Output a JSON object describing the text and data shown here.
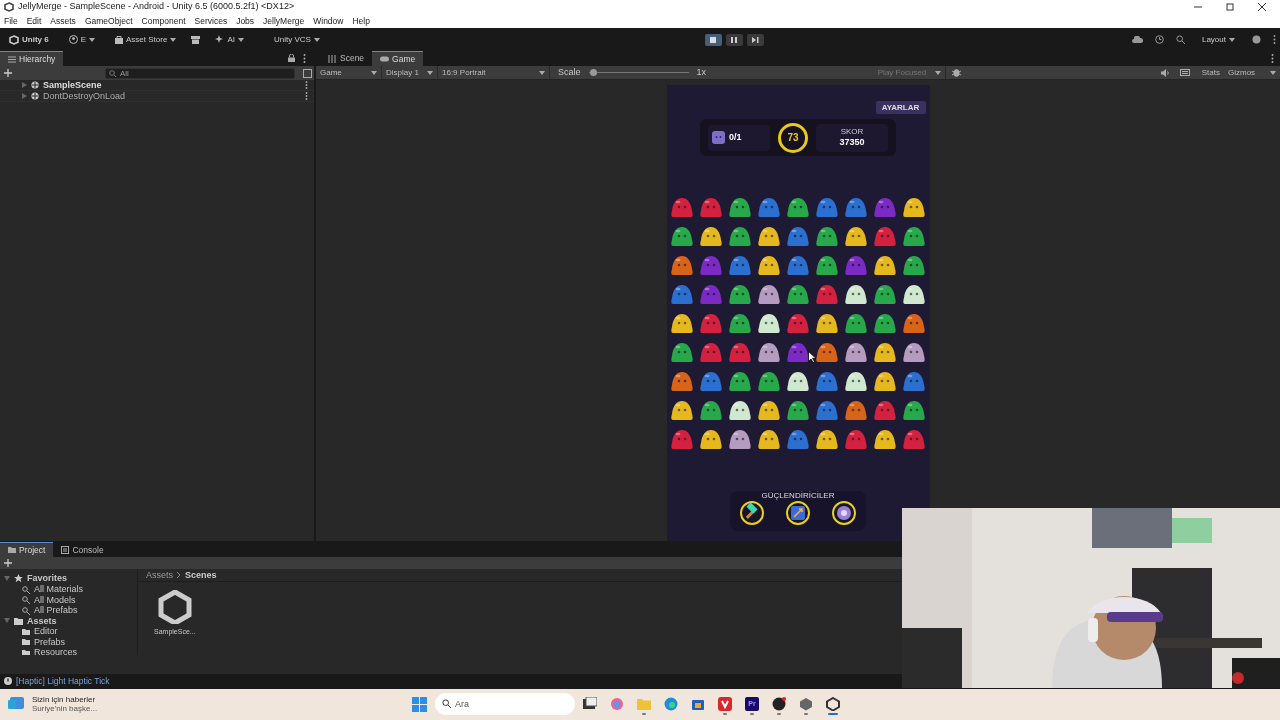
{
  "window": {
    "title": "JellyMerge - SampleScene - Android - Unity 6.5 (6000.5.2f1) <DX12>"
  },
  "menu": [
    "File",
    "Edit",
    "Assets",
    "GameObject",
    "Component",
    "Services",
    "Jobs",
    "JellyMerge",
    "Window",
    "Help"
  ],
  "toolbar": {
    "product": "Unity 6",
    "account": "E",
    "asset_store": "Asset Store",
    "ai": "AI",
    "vcs": "Unity VCS",
    "layout": "Layout",
    "play_buttons": [
      {
        "kind": "stop",
        "selected": true
      },
      {
        "kind": "pause",
        "selected": false
      },
      {
        "kind": "step",
        "selected": false
      }
    ]
  },
  "hierarchy": {
    "tab": "Hierarchy",
    "search_placeholder": "All",
    "items": [
      {
        "label": "SampleScene",
        "active": true
      },
      {
        "label": "DontDestroyOnLoad",
        "active": false
      }
    ]
  },
  "game_view": {
    "tabs": [
      {
        "label": "Scene",
        "kind": "scene",
        "selected": false
      },
      {
        "label": "Game",
        "kind": "game",
        "selected": true
      }
    ],
    "toolbar": {
      "mode": "Game",
      "display": "Display 1",
      "aspect": "16:9 Portrait",
      "scale_label": "Scale",
      "scale": {
        "level": 0.04
      },
      "scale_reading": "1x",
      "play_mode": "Play Focused",
      "stats": "Stats",
      "gizmos": "Gizmos"
    },
    "game": {
      "settings_button": "AYARLAR",
      "goal": {
        "count": "0/1"
      },
      "moves": "73",
      "score": {
        "label": "SKOR",
        "value": "37350"
      },
      "board": [
        [
          {
            "color": "#d4213f"
          },
          {
            "color": "#d4213f"
          },
          {
            "color": "#27a84a"
          },
          {
            "color": "#2b6fd0"
          },
          {
            "color": "#27a84a"
          },
          {
            "color": "#2b6fd0"
          },
          {
            "color": "#2b6fd0"
          },
          {
            "color": "#7b2bc4"
          },
          {
            "color": "#e6b81f"
          }
        ],
        [
          {
            "color": "#27a84a"
          },
          {
            "color": "#e6b81f"
          },
          {
            "color": "#27a84a"
          },
          {
            "color": "#e6b81f"
          },
          {
            "color": "#2b6fd0"
          },
          {
            "color": "#27a84a"
          },
          {
            "color": "#e6b81f"
          },
          {
            "color": "#d4213f"
          },
          {
            "color": "#27a84a"
          }
        ],
        [
          {
            "color": "#d8641a"
          },
          {
            "color": "#7b2bc4"
          },
          {
            "color": "#2b6fd0"
          },
          {
            "color": "#e6b81f"
          },
          {
            "color": "#2b6fd0"
          },
          {
            "color": "#27a84a"
          },
          {
            "color": "#7b2bc4"
          },
          {
            "color": "#e6b81f"
          },
          {
            "color": "#27a84a"
          }
        ],
        [
          {
            "color": "#2b6fd0"
          },
          {
            "color": "#7b2bc4"
          },
          {
            "color": "#27a84a"
          },
          {
            "color": "#b59bbf"
          },
          {
            "color": "#27a84a"
          },
          {
            "color": "#d4213f"
          },
          {
            "color": "#cfe8cf"
          },
          {
            "color": "#27a84a"
          },
          {
            "color": "#cfe8cf"
          }
        ],
        [
          {
            "color": "#e6b81f"
          },
          {
            "color": "#d4213f"
          },
          {
            "color": "#27a84a"
          },
          {
            "color": "#cfe8cf"
          },
          {
            "color": "#d4213f"
          },
          {
            "color": "#e6b81f"
          },
          {
            "color": "#27a84a"
          },
          {
            "color": "#27a84a"
          },
          {
            "color": "#d8641a"
          }
        ],
        [
          {
            "color": "#27a84a"
          },
          {
            "color": "#d4213f"
          },
          {
            "color": "#d4213f"
          },
          {
            "color": "#b59bbf"
          },
          {
            "color": "#7b2bc4"
          },
          {
            "color": "#d8641a"
          },
          {
            "color": "#b59bbf"
          },
          {
            "color": "#e6b81f"
          },
          {
            "color": "#b59bbf"
          }
        ],
        [
          {
            "color": "#d8641a"
          },
          {
            "color": "#2b6fd0"
          },
          {
            "color": "#27a84a"
          },
          {
            "color": "#27a84a"
          },
          {
            "color": "#cfe8cf"
          },
          {
            "color": "#2b6fd0"
          },
          {
            "color": "#cfe8cf"
          },
          {
            "color": "#e6b81f"
          },
          {
            "color": "#2b6fd0"
          }
        ],
        [
          {
            "color": "#e6b81f"
          },
          {
            "color": "#27a84a"
          },
          {
            "color": "#cfe8cf"
          },
          {
            "color": "#e6b81f"
          },
          {
            "color": "#27a84a"
          },
          {
            "color": "#2b6fd0"
          },
          {
            "color": "#d8641a"
          },
          {
            "color": "#d4213f"
          },
          {
            "color": "#27a84a"
          }
        ],
        [
          {
            "color": "#d4213f"
          },
          {
            "color": "#e6b81f"
          },
          {
            "color": "#b59bbf"
          },
          {
            "color": "#e6b81f"
          },
          {
            "color": "#2b6fd0"
          },
          {
            "color": "#e6b81f"
          },
          {
            "color": "#d4213f"
          },
          {
            "color": "#e6b81f"
          },
          {
            "color": "#d4213f"
          }
        ]
      ],
      "boosters": {
        "title": "GÜÇLENDİRİCİLER",
        "items": [
          {
            "kind": "hammer"
          },
          {
            "kind": "swap"
          },
          {
            "kind": "disco"
          }
        ]
      }
    }
  },
  "project": {
    "tabs": [
      {
        "label": "Project",
        "kind": "folder",
        "selected": true
      },
      {
        "label": "Console",
        "kind": "console",
        "selected": false
      }
    ],
    "tree": [
      {
        "label": "Favorites",
        "kind": "favorites",
        "expanded": true,
        "children": [
          {
            "label": "All Materials",
            "kind": "search"
          },
          {
            "label": "All Models",
            "kind": "search"
          },
          {
            "label": "All Prefabs",
            "kind": "search"
          }
        ]
      },
      {
        "label": "Assets",
        "kind": "folder",
        "expanded": true,
        "children": [
          {
            "label": "Editor",
            "kind": "folder"
          },
          {
            "label": "Prefabs",
            "kind": "folder"
          },
          {
            "label": "Resources",
            "kind": "folder"
          }
        ]
      }
    ],
    "breadcrumb": [
      "Assets",
      "Scenes"
    ],
    "assets": [
      {
        "label": "SampleSce..."
      }
    ]
  },
  "status_bar": "[Haptic] Light Haptic Tick",
  "taskbar": {
    "news": {
      "title": "Sizin için haberler",
      "subtitle": "Suriye'nin başke..."
    },
    "search_placeholder": "Ara",
    "apps": [
      {
        "kind": "taskview",
        "running": false,
        "selected": false
      },
      {
        "kind": "copilot",
        "running": false,
        "selected": false
      },
      {
        "kind": "explorer",
        "running": true,
        "selected": false
      },
      {
        "kind": "edge",
        "running": false,
        "selected": false
      },
      {
        "kind": "store",
        "running": false,
        "selected": false
      },
      {
        "kind": "vivaldi",
        "running": true,
        "selected": false
      },
      {
        "kind": "premiere",
        "label": "Pr",
        "running": true,
        "selected": false
      },
      {
        "kind": "obs",
        "running": true,
        "selected": false
      },
      {
        "kind": "hub",
        "running": true,
        "selected": false
      },
      {
        "kind": "unity",
        "running": true,
        "selected": true
      }
    ]
  }
}
